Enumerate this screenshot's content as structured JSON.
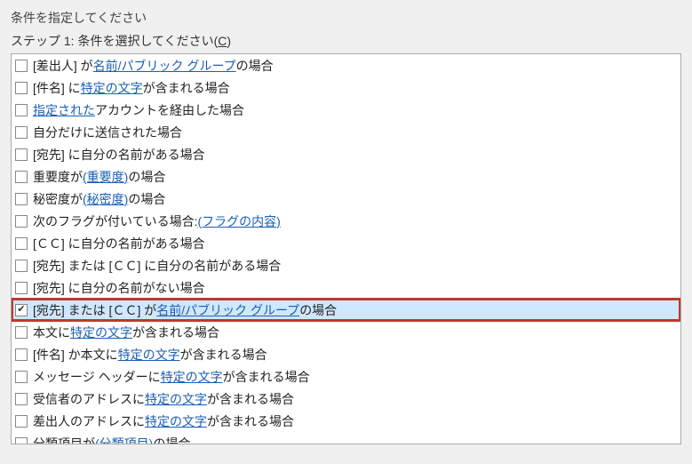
{
  "header": {
    "prompt": "条件を指定してください",
    "step_prefix": "ステップ 1: 条件を選択してください(",
    "step_key": "C",
    "step_suffix": ")"
  },
  "conditions": [
    {
      "checked": false,
      "selected": false,
      "segments": [
        {
          "t": "text",
          "v": " [差出人] が "
        },
        {
          "t": "link",
          "v": "名前/パブリック グループ"
        },
        {
          "t": "text",
          "v": " の場合"
        }
      ]
    },
    {
      "checked": false,
      "selected": false,
      "segments": [
        {
          "t": "text",
          "v": " [件名] に "
        },
        {
          "t": "link",
          "v": "特定の文字"
        },
        {
          "t": "text",
          "v": " が含まれる場合"
        }
      ]
    },
    {
      "checked": false,
      "selected": false,
      "segments": [
        {
          "t": "text",
          "v": " "
        },
        {
          "t": "link",
          "v": "指定された"
        },
        {
          "t": "text",
          "v": " アカウントを経由した場合"
        }
      ]
    },
    {
      "checked": false,
      "selected": false,
      "segments": [
        {
          "t": "text",
          "v": " 自分だけに送信された場合"
        }
      ]
    },
    {
      "checked": false,
      "selected": false,
      "segments": [
        {
          "t": "text",
          "v": " [宛先] に自分の名前がある場合"
        }
      ]
    },
    {
      "checked": false,
      "selected": false,
      "segments": [
        {
          "t": "text",
          "v": " 重要度が "
        },
        {
          "t": "link",
          "v": "(重要度)"
        },
        {
          "t": "text",
          "v": " の場合"
        }
      ]
    },
    {
      "checked": false,
      "selected": false,
      "segments": [
        {
          "t": "text",
          "v": " 秘密度が "
        },
        {
          "t": "link",
          "v": "(秘密度)"
        },
        {
          "t": "text",
          "v": " の場合"
        }
      ]
    },
    {
      "checked": false,
      "selected": false,
      "segments": [
        {
          "t": "text",
          "v": " 次のフラグが付いている場合: "
        },
        {
          "t": "link",
          "v": "(フラグの内容)"
        }
      ]
    },
    {
      "checked": false,
      "selected": false,
      "segments": [
        {
          "t": "text",
          "v": " [ＣＣ] に自分の名前がある場合"
        }
      ]
    },
    {
      "checked": false,
      "selected": false,
      "segments": [
        {
          "t": "text",
          "v": " [宛先] または [ＣＣ] に自分の名前がある場合"
        }
      ]
    },
    {
      "checked": false,
      "selected": false,
      "segments": [
        {
          "t": "text",
          "v": " [宛先] に自分の名前がない場合"
        }
      ]
    },
    {
      "checked": true,
      "selected": true,
      "highlighted": true,
      "segments": [
        {
          "t": "text",
          "v": " [宛先] または [ＣＣ] が "
        },
        {
          "t": "link",
          "v": "名前/パブリック グループ"
        },
        {
          "t": "text",
          "v": " の場合"
        }
      ]
    },
    {
      "checked": false,
      "selected": false,
      "segments": [
        {
          "t": "text",
          "v": " 本文に "
        },
        {
          "t": "link",
          "v": "特定の文字"
        },
        {
          "t": "text",
          "v": " が含まれる場合"
        }
      ]
    },
    {
      "checked": false,
      "selected": false,
      "segments": [
        {
          "t": "text",
          "v": " [件名] か本文に "
        },
        {
          "t": "link",
          "v": "特定の文字"
        },
        {
          "t": "text",
          "v": " が含まれる場合"
        }
      ]
    },
    {
      "checked": false,
      "selected": false,
      "segments": [
        {
          "t": "text",
          "v": " メッセージ ヘッダーに "
        },
        {
          "t": "link",
          "v": "特定の文字"
        },
        {
          "t": "text",
          "v": " が含まれる場合"
        }
      ]
    },
    {
      "checked": false,
      "selected": false,
      "segments": [
        {
          "t": "text",
          "v": " 受信者のアドレスに "
        },
        {
          "t": "link",
          "v": "特定の文字"
        },
        {
          "t": "text",
          "v": " が含まれる場合"
        }
      ]
    },
    {
      "checked": false,
      "selected": false,
      "segments": [
        {
          "t": "text",
          "v": " 差出人のアドレスに "
        },
        {
          "t": "link",
          "v": "特定の文字"
        },
        {
          "t": "text",
          "v": " が含まれる場合"
        }
      ]
    },
    {
      "checked": false,
      "selected": false,
      "segments": [
        {
          "t": "text",
          "v": " 分類項目が "
        },
        {
          "t": "link",
          "v": "(分類項目)"
        },
        {
          "t": "text",
          "v": " の場合"
        }
      ]
    }
  ]
}
